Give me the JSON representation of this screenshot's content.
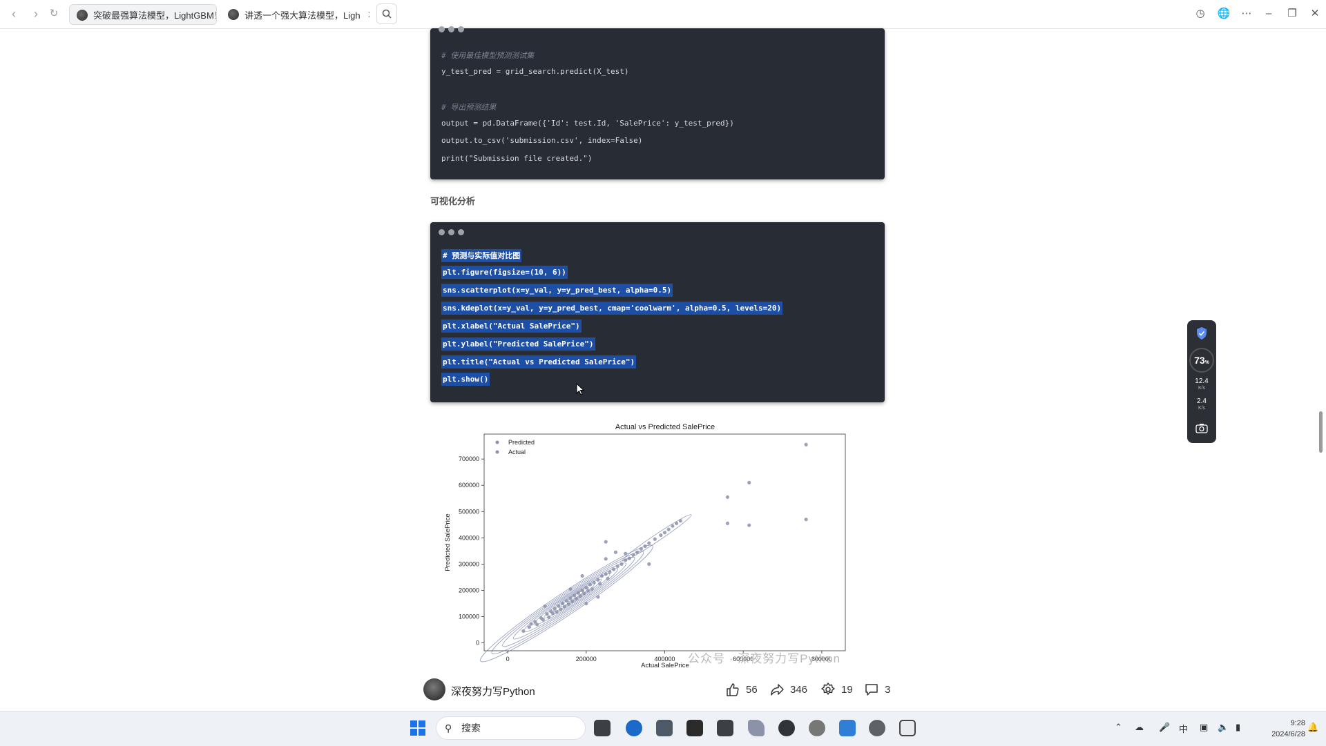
{
  "browser": {
    "tabs": [
      {
        "title": "突破最强算法模型，LightGBM！"
      },
      {
        "title": "讲透一个强大算法模型，Ligh"
      }
    ]
  },
  "code_block_1": {
    "lines": [
      {
        "text": "# 使用最佳模型预测测试集",
        "kind": "comment"
      },
      {
        "text": "y_test_pred = grid_search.predict(X_test)",
        "kind": "code"
      },
      {
        "text": "",
        "kind": "blank"
      },
      {
        "text": "# 导出预测结果",
        "kind": "comment"
      },
      {
        "text": "output = pd.DataFrame({'Id': test.Id, 'SalePrice': y_test_pred})",
        "kind": "code"
      },
      {
        "text": "output.to_csv('submission.csv', index=False)",
        "kind": "code"
      },
      {
        "text": "print(\"Submission file created.\")",
        "kind": "code"
      }
    ]
  },
  "section_heading": "可视化分析",
  "code_block_2": {
    "lines": [
      {
        "text": "# 预测与实际值对比图",
        "kind": "comment"
      },
      {
        "text": "plt.figure(figsize=(10, 6))",
        "kind": "code"
      },
      {
        "text": "sns.scatterplot(x=y_val, y=y_pred_best, alpha=0.5)",
        "kind": "code"
      },
      {
        "text": "sns.kdeplot(x=y_val, y=y_pred_best, cmap='coolwarm', alpha=0.5, levels=20)",
        "kind": "code"
      },
      {
        "text": "plt.xlabel(\"Actual SalePrice\")",
        "kind": "code"
      },
      {
        "text": "plt.ylabel(\"Predicted SalePrice\")",
        "kind": "code"
      },
      {
        "text": "plt.title(\"Actual vs Predicted SalePrice\")",
        "kind": "code"
      },
      {
        "text": "plt.show()",
        "kind": "code"
      }
    ]
  },
  "chart_data": {
    "type": "scatter",
    "title": "Actual vs Predicted SalePrice",
    "xlabel": "Actual SalePrice",
    "ylabel": "Predicted SalePrice",
    "xlim": [
      -60000,
      860000
    ],
    "ylim": [
      -30000,
      795000
    ],
    "xticks": [
      0,
      200000,
      400000,
      600000,
      800000
    ],
    "yticks": [
      0,
      100000,
      200000,
      300000,
      400000,
      500000,
      600000,
      700000
    ],
    "legend": {
      "placement": "upper-left",
      "entries": [
        "Predicted",
        "Actual"
      ]
    },
    "grid": false,
    "colors": {
      "points": "#8c92ad",
      "contours": "#6d7aa6"
    },
    "series": [
      {
        "name": "Predicted",
        "points": [
          [
            40000,
            45000
          ],
          [
            55000,
            60000
          ],
          [
            60000,
            72000
          ],
          [
            70000,
            80000
          ],
          [
            75000,
            70000
          ],
          [
            85000,
            95000
          ],
          [
            90000,
            88000
          ],
          [
            100000,
            110000
          ],
          [
            105000,
            98000
          ],
          [
            110000,
            120000
          ],
          [
            115000,
            112000
          ],
          [
            120000,
            130000
          ],
          [
            125000,
            118000
          ],
          [
            130000,
            140000
          ],
          [
            135000,
            128000
          ],
          [
            140000,
            150000
          ],
          [
            145000,
            138000
          ],
          [
            150000,
            160000
          ],
          [
            155000,
            148000
          ],
          [
            160000,
            170000
          ],
          [
            165000,
            158000
          ],
          [
            170000,
            180000
          ],
          [
            175000,
            168000
          ],
          [
            180000,
            190000
          ],
          [
            185000,
            178000
          ],
          [
            190000,
            200000
          ],
          [
            195000,
            188000
          ],
          [
            200000,
            210000
          ],
          [
            205000,
            198000
          ],
          [
            210000,
            222000
          ],
          [
            215000,
            205000
          ],
          [
            220000,
            230000
          ],
          [
            230000,
            240000
          ],
          [
            235000,
            225000
          ],
          [
            240000,
            255000
          ],
          [
            250000,
            262000
          ],
          [
            255000,
            245000
          ],
          [
            260000,
            270000
          ],
          [
            270000,
            280000
          ],
          [
            280000,
            292000
          ],
          [
            290000,
            300000
          ],
          [
            300000,
            315000
          ],
          [
            310000,
            322000
          ],
          [
            320000,
            335000
          ],
          [
            330000,
            345000
          ],
          [
            340000,
            358000
          ],
          [
            350000,
            368000
          ],
          [
            360000,
            380000
          ],
          [
            375000,
            395000
          ],
          [
            390000,
            410000
          ],
          [
            400000,
            420000
          ],
          [
            410000,
            432000
          ],
          [
            420000,
            445000
          ],
          [
            430000,
            455000
          ],
          [
            440000,
            465000
          ],
          [
            95000,
            140000
          ],
          [
            160000,
            205000
          ],
          [
            190000,
            255000
          ],
          [
            250000,
            320000
          ],
          [
            275000,
            345000
          ],
          [
            360000,
            300000
          ],
          [
            300000,
            340000
          ],
          [
            250000,
            385000
          ],
          [
            200000,
            150000
          ],
          [
            230000,
            175000
          ],
          [
            560000,
            555000
          ],
          [
            560000,
            455000
          ],
          [
            615000,
            610000
          ],
          [
            615000,
            448000
          ],
          [
            760000,
            755000
          ],
          [
            760000,
            470000
          ]
        ]
      }
    ]
  },
  "watermark": "公众号 · 深夜努力写Python",
  "author": {
    "name": "深夜努力写Python"
  },
  "stats": {
    "likes": "56",
    "shares": "346",
    "favorites": "19",
    "comments": "3"
  },
  "monitor": {
    "percent": "73",
    "percent_unit": "%",
    "up_speed": "12.4",
    "down_speed": "2.4",
    "speed_unit": "K/s"
  },
  "taskbar": {
    "search_placeholder": "搜索",
    "ime": "中",
    "time": "9:28",
    "date": "2024/6/28"
  }
}
